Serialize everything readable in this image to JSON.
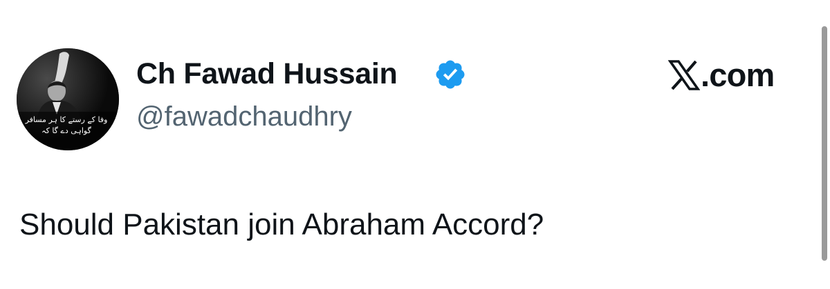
{
  "tweet": {
    "author": {
      "display_name": "Ch Fawad Hussain",
      "handle": "@fawadchaudhry",
      "verified": true,
      "avatar_icon": "profile-photo",
      "avatar_caption_urdu": "وفا کے رستے کا ہر مسافر گواہی دے گا کہ"
    },
    "text": "Should Pakistan join Abraham Accord?"
  },
  "branding": {
    "logo_icon": "x-logo-icon",
    "text": ".com"
  },
  "colors": {
    "text_primary": "#0f1419",
    "text_secondary": "#536471",
    "verified_blue": "#1d9bf0",
    "background": "#ffffff",
    "scrollbar": "#9a9a9a"
  }
}
